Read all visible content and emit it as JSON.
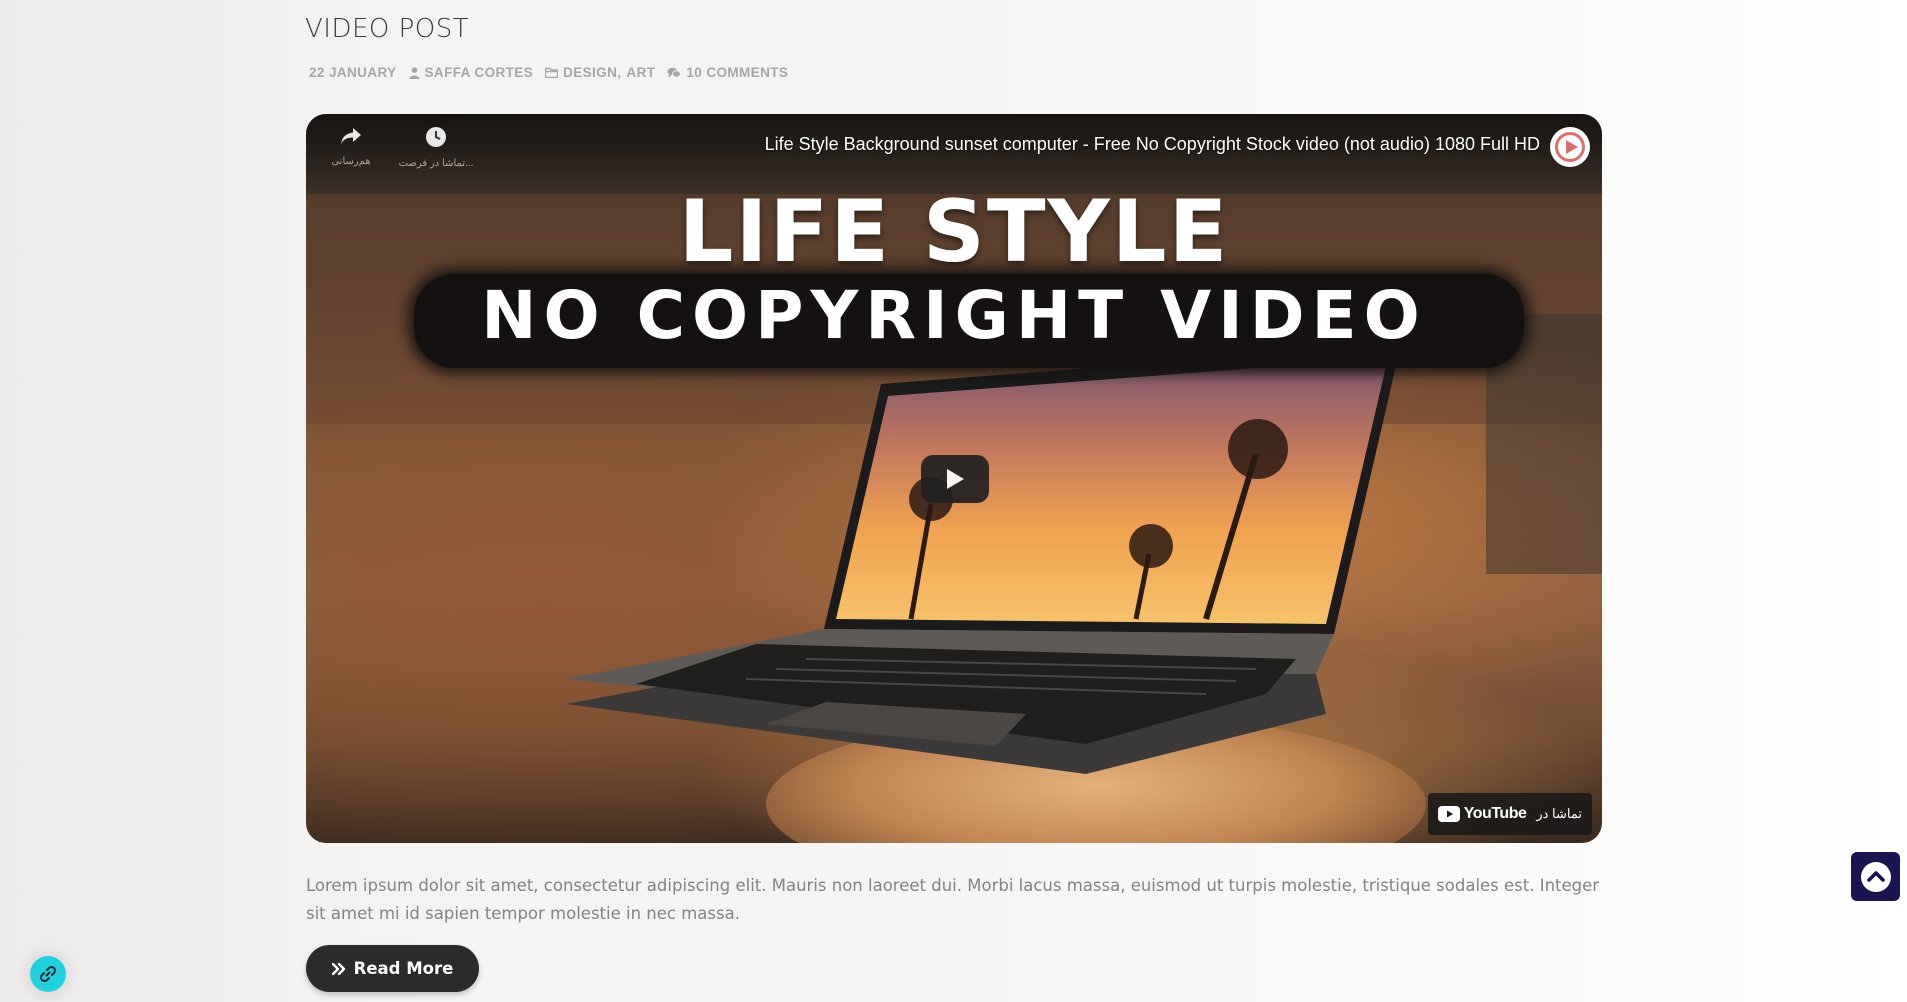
{
  "post": {
    "title": "VIDEO POST",
    "meta": {
      "date": "22 JANUARY",
      "author": "SAFFA CORTES",
      "category_1": "DESIGN",
      "category_sep": ",",
      "category_2": "ART",
      "comments": "10 COMMENTS"
    },
    "excerpt": "Lorem ipsum dolor sit amet, consectetur adipiscing elit. Mauris non laoreet dui. Morbi lacus massa, euismod ut turpis molestie, tristique sodales est. Integer sit amet mi id sapien tempor molestie in nec massa.",
    "read_more_label": "Read More"
  },
  "video": {
    "title": "Life Style Background sunset computer - Free No Copyright Stock video (not audio) 1080 Full HD",
    "thumbnail_line1": "LIFE STYLE",
    "thumbnail_line2": "NO COPYRIGHT VIDEO",
    "share_label": "هم‌رسانی",
    "watch_later_label": "تماشا در فرصت...",
    "watch_on_label": "تماشا در",
    "youtube_label": "YouTube"
  },
  "icons": {
    "date": "none",
    "author": "user-icon",
    "category": "folder-icon",
    "comments": "comments-icon",
    "read_more": "double-chevron-right-icon",
    "scroll_top": "chevron-up-circle-icon",
    "link": "link-icon",
    "play": "play-icon"
  },
  "colors": {
    "scroll_top_bg": "#1a1450",
    "link_float_bg": "#1fd0dd",
    "read_more_bg": "#2b2b2b"
  }
}
